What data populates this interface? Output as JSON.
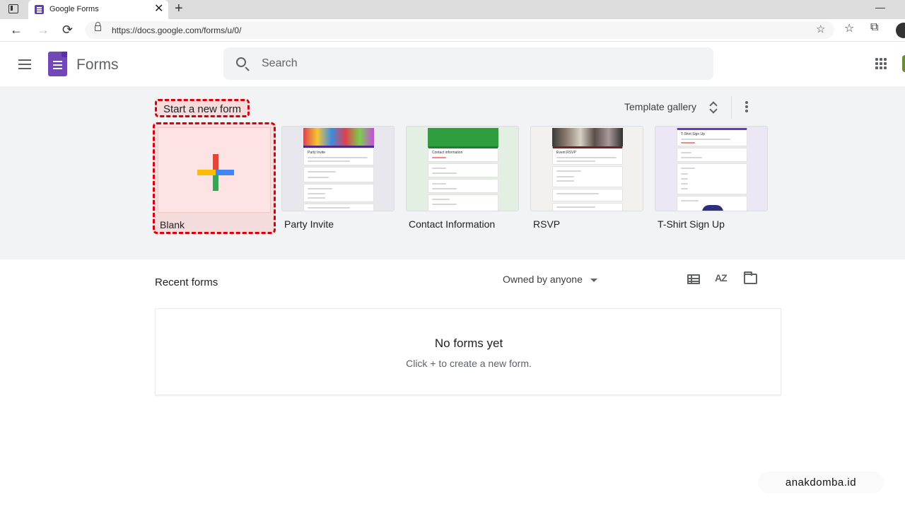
{
  "browser": {
    "tab_title": "Google Forms",
    "tab_close": "✕",
    "new_tab": "+",
    "url": "https://docs.google.com/forms/u/0/",
    "back": "←",
    "forward": "→",
    "reload": "⟳",
    "minimize": "—",
    "icons": [
      "tab-actions-icon",
      "back-arrow-icon",
      "forward-arrow-icon",
      "reload-icon",
      "lock-icon",
      "favorite-star-icon",
      "favorites-icon",
      "collections-icon",
      "profile-icon"
    ]
  },
  "header": {
    "app_name": "Forms",
    "search_placeholder": "Search"
  },
  "start_section": {
    "title": "Start a new form",
    "template_gallery": "Template gallery",
    "templates": [
      {
        "name": "Blank"
      },
      {
        "name": "Party Invite"
      },
      {
        "name": "Contact Information"
      },
      {
        "name": "RSVP"
      },
      {
        "name": "T-Shirt Sign Up"
      }
    ],
    "previews": {
      "party_invite": "Party Invite",
      "contact_info": "Contact information",
      "rsvp": "Event RSVP",
      "tshirt": "T-Shirt Sign Up"
    }
  },
  "recent": {
    "title": "Recent forms",
    "owner_filter": "Owned by anyone",
    "sort_label": "AZ",
    "empty_title": "No forms yet",
    "empty_subtitle": "Click + to create a new form."
  },
  "watermark": "anakdomba.id",
  "colors": {
    "forms_purple": "#7248b9",
    "highlight_red": "#d8000c",
    "section_bg": "#f1f3f4",
    "contact_green": "#2e9e3e",
    "party_purple": "#4c2a85",
    "tshirt_purple": "#673ab7"
  }
}
